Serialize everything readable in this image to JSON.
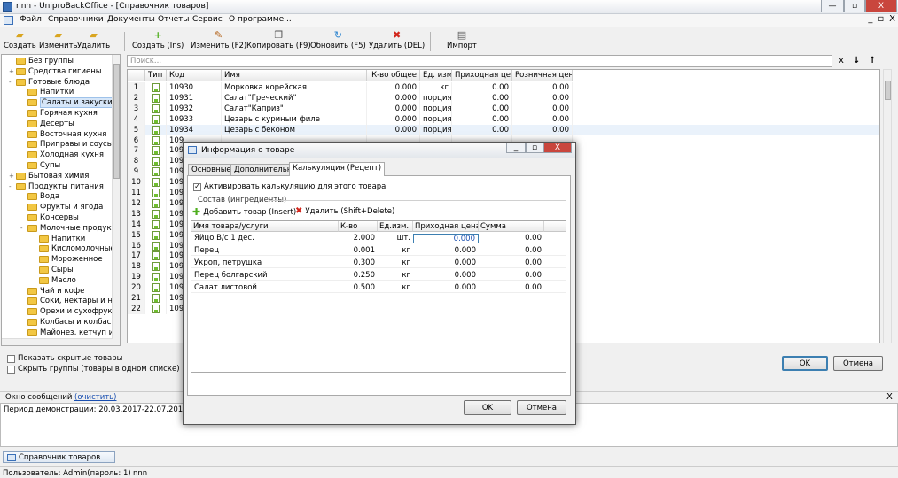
{
  "window": {
    "title": "nnn - UniproBackOffice - [Справочник товаров]",
    "min": "—",
    "max": "▫",
    "close": "X"
  },
  "menu": [
    "Файл",
    "Справочники",
    "Документы",
    "Отчеты",
    "Сервис",
    "О программе..."
  ],
  "mdi": {
    "min": "_",
    "restore": "▫",
    "close": "X"
  },
  "left_toolbar": {
    "create": "Создать",
    "edit": "Изменить",
    "delete": "Удалить"
  },
  "toolbar": {
    "create": "Создать (Ins)",
    "edit": "Изменить (F2)",
    "copy": "Копировать (F9)",
    "refresh": "Обновить (F5)",
    "delete": "Удалить (DEL)",
    "import": "Импорт"
  },
  "search": {
    "placeholder": "Поиск...",
    "clear": "x",
    "down": "↓",
    "up": "↑"
  },
  "tree": [
    {
      "label": "Без группы",
      "level": 0,
      "exp": ""
    },
    {
      "label": "Средства гигиены",
      "level": 0,
      "exp": "+"
    },
    {
      "label": "Готовые блюда",
      "level": 0,
      "exp": "-"
    },
    {
      "label": "Напитки",
      "level": 1,
      "exp": ""
    },
    {
      "label": "Салаты и закуски",
      "level": 1,
      "exp": "",
      "selected": true
    },
    {
      "label": "Горячая кухня",
      "level": 1,
      "exp": ""
    },
    {
      "label": "Десерты",
      "level": 1,
      "exp": ""
    },
    {
      "label": "Восточная кухня",
      "level": 1,
      "exp": ""
    },
    {
      "label": "Приправы и соусы",
      "level": 1,
      "exp": ""
    },
    {
      "label": "Холодная кухня",
      "level": 1,
      "exp": ""
    },
    {
      "label": "Супы",
      "level": 1,
      "exp": ""
    },
    {
      "label": "Бытовая химия",
      "level": 0,
      "exp": "+"
    },
    {
      "label": "Продукты питания",
      "level": 0,
      "exp": "-"
    },
    {
      "label": "Вода",
      "level": 1,
      "exp": ""
    },
    {
      "label": "Фрукты и ягода",
      "level": 1,
      "exp": ""
    },
    {
      "label": "Консервы",
      "level": 1,
      "exp": ""
    },
    {
      "label": "Молочные продукты",
      "level": 1,
      "exp": "-"
    },
    {
      "label": "Напитки",
      "level": 2,
      "exp": ""
    },
    {
      "label": "Кисломолочные",
      "level": 2,
      "exp": ""
    },
    {
      "label": "Мороженное",
      "level": 2,
      "exp": ""
    },
    {
      "label": "Сыры",
      "level": 2,
      "exp": ""
    },
    {
      "label": "Масло",
      "level": 2,
      "exp": ""
    },
    {
      "label": "Чай и кофе",
      "level": 1,
      "exp": ""
    },
    {
      "label": "Соки, нектары и на",
      "level": 1,
      "exp": ""
    },
    {
      "label": "Орехи и сухофрукт",
      "level": 1,
      "exp": ""
    },
    {
      "label": "Колбасы и колбасн",
      "level": 1,
      "exp": ""
    },
    {
      "label": "Майонез, кетчуп и с",
      "level": 1,
      "exp": ""
    }
  ],
  "options": {
    "show_hidden": "Показать скрытые товары",
    "hide_groups": "Скрыть группы (товары в одном списке)"
  },
  "grid": {
    "headers": [
      "Тип",
      "Код",
      "Имя",
      "К-во общее",
      "Ед. изм.",
      "Приходная цена",
      "Розничная цена"
    ],
    "rows": [
      {
        "n": "1",
        "code": "10930",
        "name": "Морковка корейская",
        "qty": "0.000",
        "unit": "кг",
        "in": "0.00",
        "rt": "0.00"
      },
      {
        "n": "2",
        "code": "10931",
        "name": "Салат\"Греческий\"",
        "qty": "0.000",
        "unit": "порция",
        "in": "0.00",
        "rt": "0.00"
      },
      {
        "n": "3",
        "code": "10932",
        "name": "Салат\"Каприз\"",
        "qty": "0.000",
        "unit": "порция",
        "in": "0.00",
        "rt": "0.00"
      },
      {
        "n": "4",
        "code": "10933",
        "name": "Цезарь с куриным филе",
        "qty": "0.000",
        "unit": "порция",
        "in": "0.00",
        "rt": "0.00"
      },
      {
        "n": "5",
        "code": "10934",
        "name": "Цезарь с беконом",
        "qty": "0.000",
        "unit": "порция",
        "in": "0.00",
        "rt": "0.00"
      },
      {
        "n": "6",
        "code": "109",
        "name": "",
        "qty": "",
        "unit": "",
        "in": "",
        "rt": ""
      },
      {
        "n": "7",
        "code": "109",
        "name": "",
        "qty": "",
        "unit": "",
        "in": "",
        "rt": ""
      },
      {
        "n": "8",
        "code": "109",
        "name": "",
        "qty": "",
        "unit": "",
        "in": "",
        "rt": ""
      },
      {
        "n": "9",
        "code": "109",
        "name": "",
        "qty": "",
        "unit": "",
        "in": "",
        "rt": ""
      },
      {
        "n": "10",
        "code": "109",
        "name": "",
        "qty": "",
        "unit": "",
        "in": "",
        "rt": ""
      },
      {
        "n": "11",
        "code": "109",
        "name": "",
        "qty": "",
        "unit": "",
        "in": "",
        "rt": ""
      },
      {
        "n": "12",
        "code": "109",
        "name": "",
        "qty": "",
        "unit": "",
        "in": "",
        "rt": ""
      },
      {
        "n": "13",
        "code": "109",
        "name": "",
        "qty": "",
        "unit": "",
        "in": "",
        "rt": ""
      },
      {
        "n": "14",
        "code": "109",
        "name": "",
        "qty": "",
        "unit": "",
        "in": "",
        "rt": ""
      },
      {
        "n": "15",
        "code": "109",
        "name": "",
        "qty": "",
        "unit": "",
        "in": "",
        "rt": ""
      },
      {
        "n": "16",
        "code": "109",
        "name": "",
        "qty": "",
        "unit": "",
        "in": "",
        "rt": ""
      },
      {
        "n": "17",
        "code": "109",
        "name": "",
        "qty": "",
        "unit": "",
        "in": "",
        "rt": ""
      },
      {
        "n": "18",
        "code": "109",
        "name": "",
        "qty": "",
        "unit": "",
        "in": "",
        "rt": ""
      },
      {
        "n": "19",
        "code": "109",
        "name": "",
        "qty": "",
        "unit": "",
        "in": "",
        "rt": ""
      },
      {
        "n": "20",
        "code": "109",
        "name": "",
        "qty": "",
        "unit": "",
        "in": "",
        "rt": ""
      },
      {
        "n": "21",
        "code": "109",
        "name": "",
        "qty": "",
        "unit": "",
        "in": "",
        "rt": ""
      },
      {
        "n": "22",
        "code": "109",
        "name": "",
        "qty": "",
        "unit": "",
        "in": "",
        "rt": ""
      }
    ]
  },
  "main_buttons": {
    "ok": "OK",
    "cancel": "Отмена"
  },
  "messages": {
    "title": "Окно сообщений",
    "clear": "(очистить)",
    "close": "X",
    "text": "Период демонстрации: 20.03.2017-22.07.2017"
  },
  "taskbar": {
    "item": "Справочник товаров"
  },
  "status": {
    "user": "Пользователь: Admin(пароль: 1)",
    "db": "nnn"
  },
  "dialog": {
    "title": "Информация о товаре",
    "min": "_",
    "max": "▫",
    "close": "X",
    "tabs": [
      "Основные",
      "Дополнительно",
      "Калькуляция (Рецепт)"
    ],
    "activate": "Активировать калькуляцию для этого товара",
    "group": "Состав (ингредиенты)",
    "add": "Добавить товар (Insert)",
    "remove": "Удалить (Shift+Delete)",
    "headers": [
      "Имя товара/услуги",
      "К-во",
      "Ед.изм.",
      "Приходная цена",
      "Сумма"
    ],
    "rows": [
      {
        "name": "Яйцо В/с 1 дес.",
        "qty": "2.000",
        "unit": "шт.",
        "price": "0.000",
        "sum": "0.00"
      },
      {
        "name": "Перец",
        "qty": "0.001",
        "unit": "кг",
        "price": "0.000",
        "sum": "0.00"
      },
      {
        "name": "Укроп, петрушка",
        "qty": "0.300",
        "unit": "кг",
        "price": "0.000",
        "sum": "0.00"
      },
      {
        "name": "Перец болгарский",
        "qty": "0.250",
        "unit": "кг",
        "price": "0.000",
        "sum": "0.00"
      },
      {
        "name": "Салат листовой",
        "qty": "0.500",
        "unit": "кг",
        "price": "0.000",
        "sum": "0.00"
      }
    ],
    "ok": "OK",
    "cancel": "Отмена"
  }
}
